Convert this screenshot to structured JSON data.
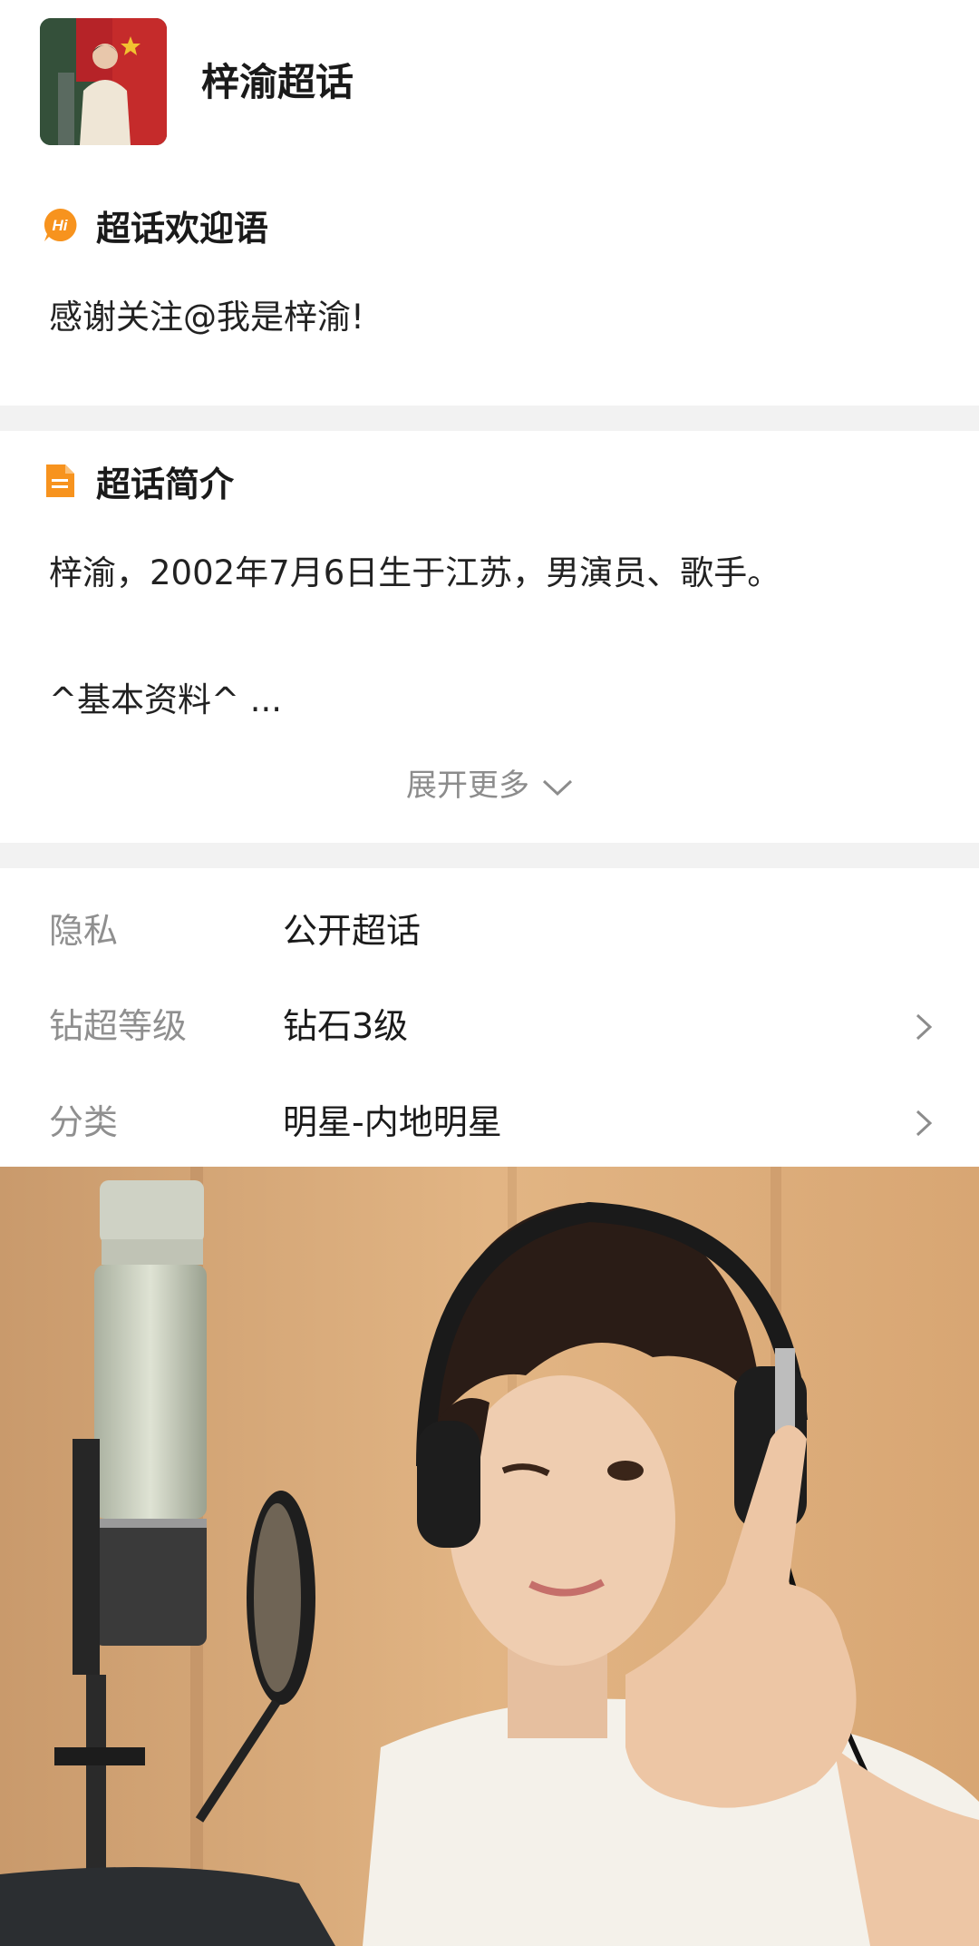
{
  "header": {
    "topic_name": "梓渝超话",
    "avatar_icon": "avatar-photo"
  },
  "welcome": {
    "icon": "hi-badge-icon",
    "icon_text": "Hi",
    "title": "超话欢迎语",
    "text": "感谢关注@我是梓渝!"
  },
  "intro": {
    "icon": "document-icon",
    "title": "超话简介",
    "line1": "梓渝，2002年7月6日生于江苏，男演员、歌手。",
    "line2": "^基本资料^ ...",
    "expand_label": "展开更多"
  },
  "info": {
    "rows": [
      {
        "label": "隐私",
        "value": "公开超话",
        "has_arrow": false
      },
      {
        "label": "钻超等级",
        "value": "钻石3级",
        "has_arrow": true
      },
      {
        "label": "分类",
        "value": "明星-内地明星",
        "has_arrow": true
      }
    ]
  },
  "colors": {
    "accent_orange": "#f7931e",
    "divider_gray": "#f2f2f2",
    "label_gray": "#8f8f8f"
  }
}
